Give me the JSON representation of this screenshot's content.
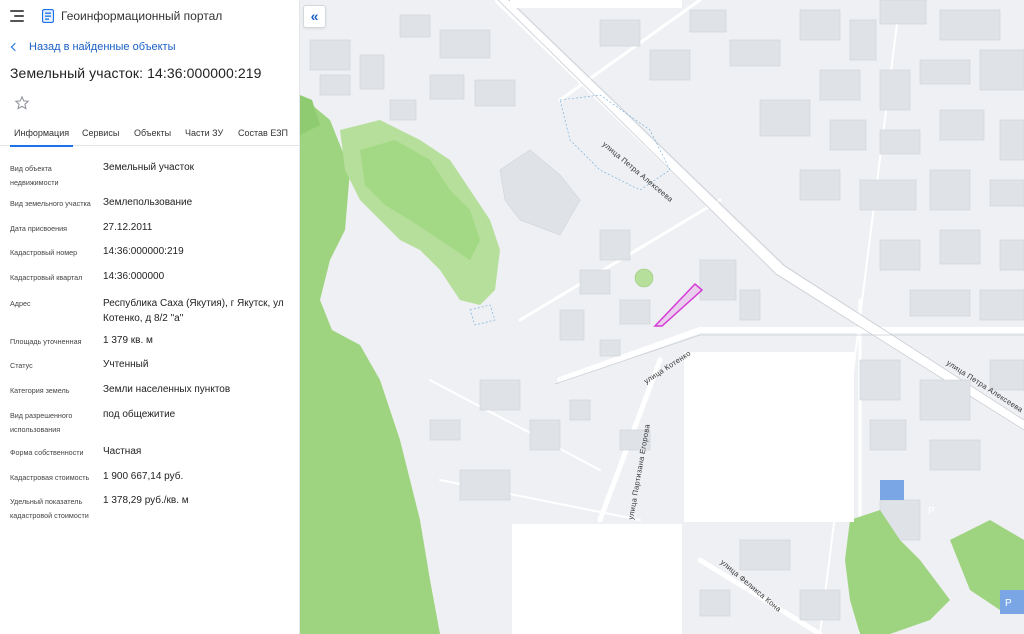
{
  "header": {
    "menu_icon": "hamburger-icon",
    "logo_icon": "portal-logo-icon",
    "title": "Геоинформационный портал"
  },
  "nav": {
    "back_label": "Назад в найденные объекты"
  },
  "object": {
    "title": "Земельный участок: 14:36:000000:219",
    "favorite_icon": "star-icon"
  },
  "tabs": [
    {
      "label": "Информация",
      "active": true
    },
    {
      "label": "Сервисы"
    },
    {
      "label": "Объекты"
    },
    {
      "label": "Части ЗУ"
    },
    {
      "label": "Состав ЕЗП"
    }
  ],
  "info": [
    {
      "label": "Вид объекта недвижимости",
      "value": "Земельный участок"
    },
    {
      "label": "Вид земельного участка",
      "value": "Землепользование"
    },
    {
      "label": "Дата присвоения",
      "value": "27.12.2011"
    },
    {
      "label": "Кадастровый номер",
      "value": "14:36:000000:219"
    },
    {
      "label": "Кадастровый квартал",
      "value": "14:36:000000"
    },
    {
      "label": "Адрес",
      "value": "Республика Саха (Якутия), г Якутск, ул Котенко, д 8/2 \"а\""
    },
    {
      "label": "Площадь уточненная",
      "value": "1 379 кв. м"
    },
    {
      "label": "Статус",
      "value": "Учтенный"
    },
    {
      "label": "Категория земель",
      "value": "Земли населенных пунктов"
    },
    {
      "label": "Вид разрешенного использования",
      "value": "под общежитие"
    },
    {
      "label": "Форма собственности",
      "value": "Частная"
    },
    {
      "label": "Кадастровая стоимость",
      "value": "1 900 667,14 руб."
    },
    {
      "label": "Удельный показатель кадастровой стоимости",
      "value": "1 378,29 руб./кв. м"
    }
  ],
  "map": {
    "collapse_icon": "double-chevron-left-icon",
    "collapse_glyph": "«",
    "streets": [
      "улица Петра Алексеева",
      "улица Петра Алексеева",
      "улица Котенко",
      "улица Партизана Егорова",
      "улица Феликса Кона"
    ],
    "parking_label": "P",
    "parcel_color": "#d63ad6",
    "forest_color": "#9ed37f",
    "building_color": "#dfe2e6",
    "background_color": "#eef0f3"
  }
}
